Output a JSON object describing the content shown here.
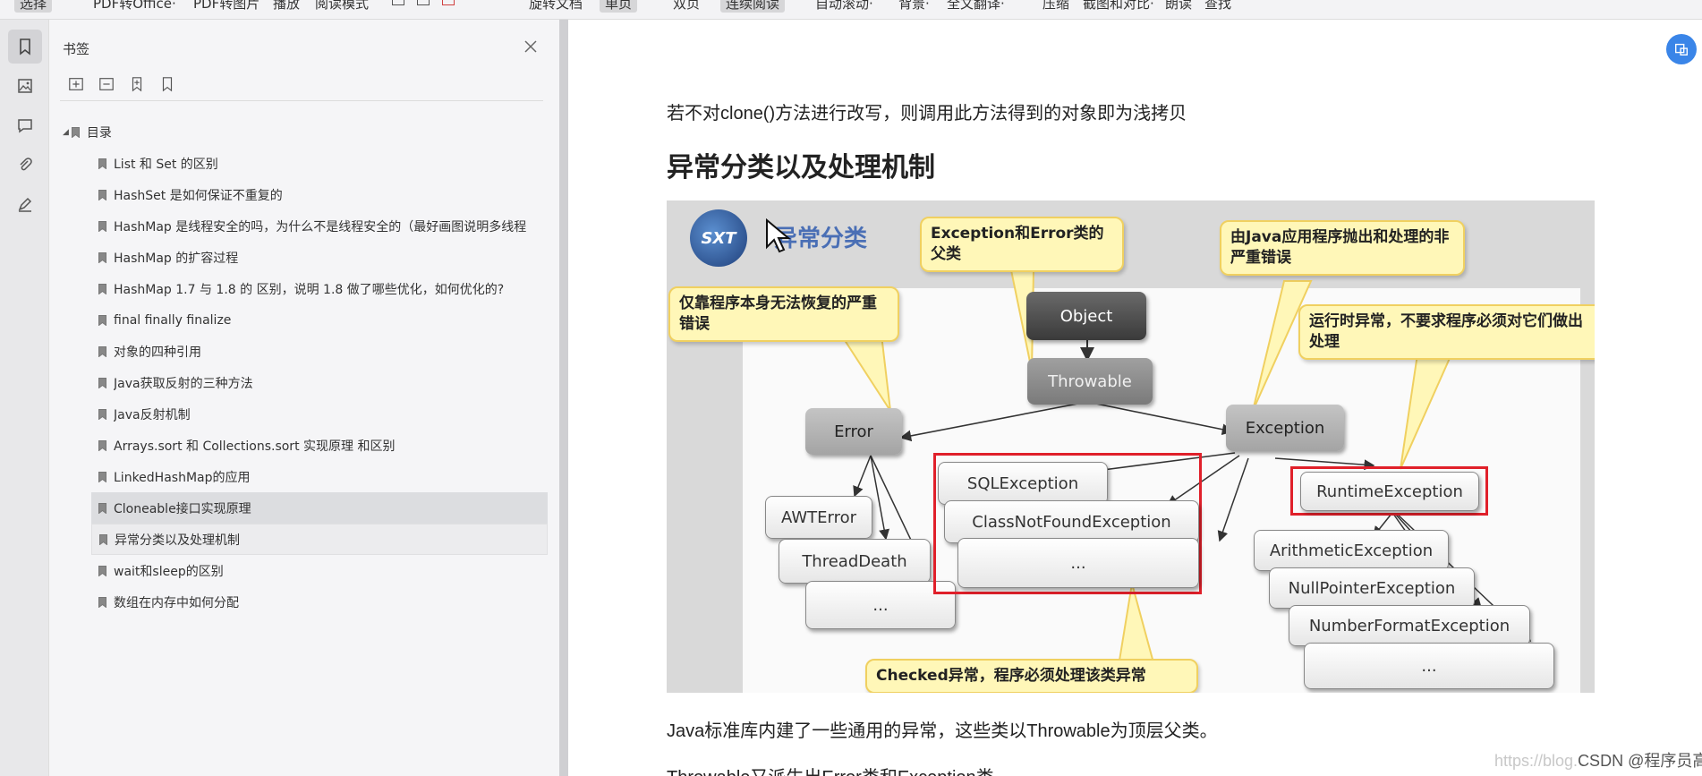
{
  "toolbar": {
    "items": [
      {
        "label": "选择",
        "active": true
      },
      {
        "label": "PDF转Office·"
      },
      {
        "label": "PDF转图片"
      },
      {
        "label": "播放"
      },
      {
        "label": "阅读模式"
      },
      {
        "label": "旋转文档"
      },
      {
        "label": "单页",
        "active": true
      },
      {
        "label": "双页"
      },
      {
        "label": "连续阅读",
        "active": true
      },
      {
        "label": "自动滚动·"
      },
      {
        "label": "背景·"
      },
      {
        "label": "全文翻译·"
      },
      {
        "label": "压缩"
      },
      {
        "label": "截图和对比·"
      },
      {
        "label": "朗读"
      },
      {
        "label": "查找"
      }
    ]
  },
  "rail": {
    "buttons": [
      {
        "name": "bookmark-icon",
        "active": true
      },
      {
        "name": "thumbnail-icon"
      },
      {
        "name": "comment-icon"
      },
      {
        "name": "attachment-icon"
      },
      {
        "name": "signature-icon"
      }
    ]
  },
  "bookmark_panel": {
    "title": "书签",
    "tools": [
      "add-bookmark-icon",
      "remove-bookmark-icon",
      "insert-bookmark-icon",
      "bookmark-outline-icon"
    ],
    "root": {
      "label": "目录",
      "expanded": true
    },
    "items": [
      {
        "label": "List 和 Set 的区别"
      },
      {
        "label": "HashSet 是如何保证不重复的"
      },
      {
        "label": "HashMap 是线程安全的吗，为什么不是线程安全的（最好画图说明多线程"
      },
      {
        "label": "HashMap 的扩容过程"
      },
      {
        "label": "HashMap 1.7 与 1.8 的 区别，说明 1.8 做了哪些优化，如何优化的?"
      },
      {
        "label": "final finally finalize"
      },
      {
        "label": "对象的四种引用"
      },
      {
        "label": "Java获取反射的三种方法"
      },
      {
        "label": "Java反射机制"
      },
      {
        "label": "Arrays.sort 和 Collections.sort 实现原理 和区别"
      },
      {
        "label": "LinkedHashMap的应用"
      },
      {
        "label": "Cloneable接口实现原理",
        "state": "selected"
      },
      {
        "label": "异常分类以及处理机制",
        "state": "hovered"
      },
      {
        "label": "wait和sleep的区别"
      },
      {
        "label": "数组在内存中如何分配"
      }
    ]
  },
  "document": {
    "para1": "若不对clone()方法进行改写，则调用此方法得到的对象即为浅拷贝",
    "heading": "异常分类以及处理机制",
    "para2": "Java标准库内建了一些通用的异常，这些类以Throwable为顶层父类。",
    "para3": "Throwable又派生出Error类和Exception类。",
    "figure": {
      "logo": "SXT",
      "title": "异常分类",
      "callouts": {
        "error_desc": "仅靠程序本身无法恢复的严重错误",
        "parent_desc": "Exception和Error类的父类",
        "exception_desc": "由Java应用程序抛出和处理的非严重错误",
        "runtime_desc": "运行时异常，不要求程序必须对它们做出处理",
        "checked_desc": "Checked异常，程序必须处理该类异常"
      },
      "nodes": {
        "object": "Object",
        "throwable": "Throwable",
        "error": "Error",
        "exception": "Exception",
        "awt_error": "AWTError",
        "thread_death": "ThreadDeath",
        "error_more": "...",
        "sql_exception": "SQLException",
        "class_not_found": "ClassNotFoundException",
        "checked_more": "...",
        "runtime_exception": "RuntimeException",
        "arithmetic": "ArithmeticException",
        "null_pointer": "NullPointerException",
        "number_format": "NumberFormatException",
        "runtime_more": "..."
      }
    }
  },
  "watermark": {
    "faint": "https://blog.",
    "text": "CSDN @程序员高级码农"
  },
  "colors": {
    "accent": "#3a85e8",
    "highlight": "#e0202a",
    "callout": "#fff7b8"
  }
}
